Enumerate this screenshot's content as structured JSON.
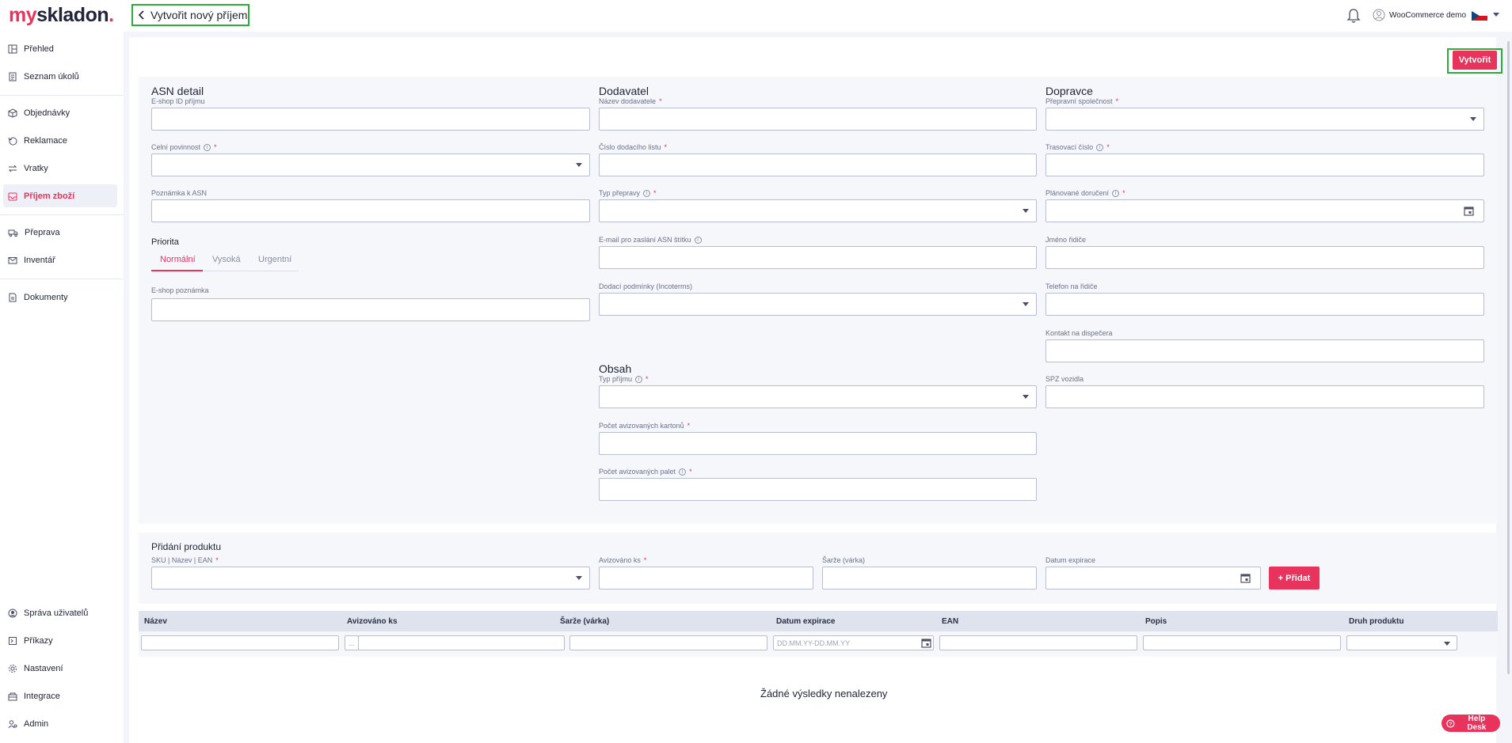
{
  "brand": {
    "logo_my": "my",
    "logo_rest": "skladon",
    "logo_dot": ".",
    "accent": "#e8335c",
    "highlight": "#2cae3a"
  },
  "header": {
    "back_title": "Vytvořit nový příjem",
    "user_name": "WooCommerce demo"
  },
  "sidebar": {
    "items": [
      {
        "label": "Přehled",
        "icon": "dashboard-icon"
      },
      {
        "label": "Seznam úkolů",
        "icon": "task-list-icon"
      },
      {
        "label": "Objednávky",
        "icon": "box-icon"
      },
      {
        "label": "Reklamace",
        "icon": "return-icon"
      },
      {
        "label": "Vratky",
        "icon": "exchange-icon"
      },
      {
        "label": "Příjem zboží",
        "icon": "inbox-icon",
        "active": true
      },
      {
        "label": "Přeprava",
        "icon": "truck-icon"
      },
      {
        "label": "Inventář",
        "icon": "mail-icon"
      },
      {
        "label": "Dokumenty",
        "icon": "document-icon"
      },
      {
        "label": "Správa uživatelů",
        "icon": "users-icon"
      },
      {
        "label": "Příkazy",
        "icon": "command-icon"
      },
      {
        "label": "Nastavení",
        "icon": "gear-icon"
      },
      {
        "label": "Integrace",
        "icon": "integration-icon"
      },
      {
        "label": "Admin",
        "icon": "admin-icon"
      }
    ]
  },
  "toolbar": {
    "create_label": "Vytvořit"
  },
  "asn": {
    "title": "ASN detail",
    "eshop_id": "E-shop ID příjmu",
    "customs": "Celní povinnost",
    "note": "Poznámka k ASN",
    "priority_title": "Priorita",
    "tabs": [
      "Normální",
      "Vysoká",
      "Urgentní"
    ],
    "eshop_note": "E-shop poznámka"
  },
  "supplier": {
    "title": "Dodavatel",
    "name": "Název dodavatele",
    "delivery_note": "Číslo dodacího listu",
    "transport_type": "Typ přepravy",
    "email": "E-mail pro zaslání ASN štítku",
    "incoterms": "Dodací podmínky (Incoterms)"
  },
  "content": {
    "title": "Obsah",
    "receipt_type": "Typ příjmu",
    "cartons": "Počet avizovaných kartonů",
    "pallets": "Počet avizovaných palet"
  },
  "carrier": {
    "title": "Dopravce",
    "company": "Přepravní společnost",
    "tracking": "Trasovací číslo",
    "planned": "Plánované doručení",
    "driver_name": "Jméno řidiče",
    "driver_phone": "Telefon na řidiče",
    "dispatcher": "Kontakt na dispečera",
    "plate": "SPZ vozidla"
  },
  "product": {
    "title": "Přidání produktu",
    "sku": "SKU | Název | EAN",
    "announced": "Avizováno ks",
    "batch": "Šarže (várka)",
    "expiry": "Datum expirace",
    "add_label": "+ Přidat"
  },
  "table": {
    "columns": [
      "Název",
      "Avizováno ks",
      "Šarže (várka)",
      "Datum expirace",
      "EAN",
      "Popis",
      "Druh produktu"
    ],
    "range_prefix": "...",
    "date_placeholder": "DD.MM.YY-DD.MM.YY",
    "empty": "Žádné výsledky nenalezeny"
  },
  "help": {
    "label": "Help Desk"
  }
}
